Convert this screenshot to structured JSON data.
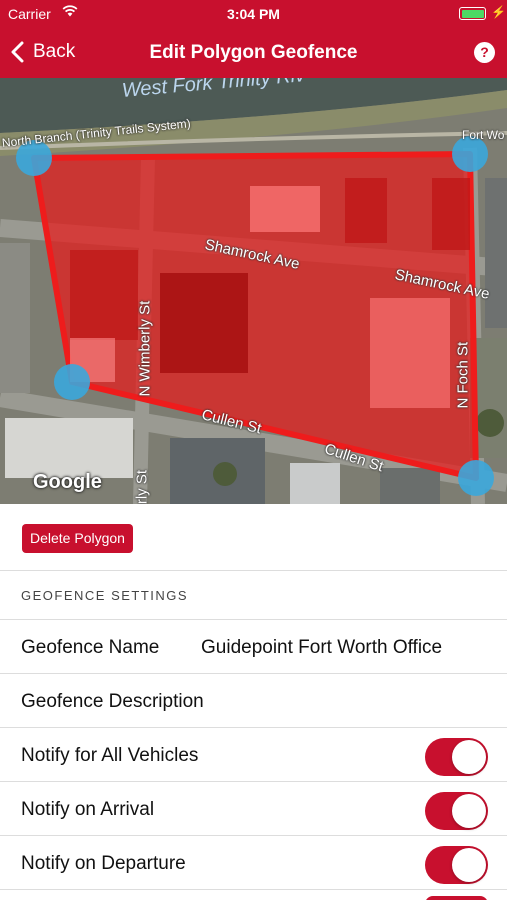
{
  "status_bar": {
    "carrier": "Carrier",
    "time": "3:04 PM"
  },
  "nav": {
    "back_label": "Back",
    "title": "Edit Polygon Geofence",
    "help_glyph": "?"
  },
  "map": {
    "labels": {
      "river": "West Fork Trinity Riv",
      "trail": "North Branch (Trinity Trails System)",
      "fort_worth": "Fort Wo",
      "shamrock_1": "Shamrock Ave",
      "shamrock_2": "Shamrock Ave",
      "wimberly_1": "N Wimberly St",
      "wimberly_2": "erly St",
      "cullen_1": "Cullen St",
      "cullen_2": "Cullen St",
      "foch": "N Foch St",
      "google": "Google"
    },
    "polygon_fill": "#e81b1b",
    "vertex_color": "#3ba7dc"
  },
  "delete_button": "Delete Polygon",
  "section_header": "GEOFENCE SETTINGS",
  "settings": {
    "name_label": "Geofence Name",
    "name_value": "Guidepoint Fort Worth Office",
    "description_label": "Geofence Description",
    "notify_all_label": "Notify for All Vehicles",
    "notify_all": true,
    "notify_arrival_label": "Notify on Arrival",
    "notify_arrival": true,
    "notify_departure_label": "Notify on Departure",
    "notify_departure": true
  },
  "colors": {
    "brand": "#c8102e",
    "toggle_on": "#c8102e"
  }
}
